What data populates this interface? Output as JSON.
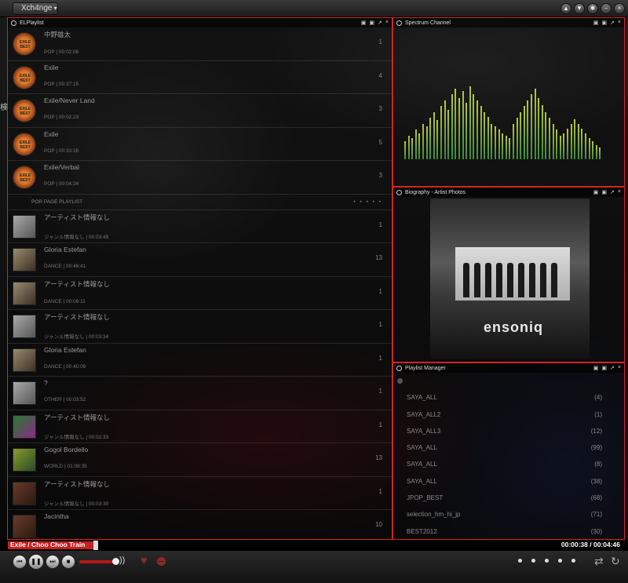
{
  "topbar": {
    "skin_menu": "Xch4nge",
    "buttons": [
      "up-icon",
      "down-icon",
      "gear-icon",
      "minimize-icon",
      "close-icon"
    ]
  },
  "side_glyph": "検",
  "playlist": {
    "title": "ELPlaylist",
    "items": [
      {
        "artist": "中野雄太",
        "song": "",
        "meta": "POP | 00:02:06",
        "num": "1",
        "thumb": "exile"
      },
      {
        "artist": "Exile",
        "song": "",
        "meta": "POP | 00:37:15",
        "num": "4",
        "thumb": "exile"
      },
      {
        "artist": "Exile/Never Land",
        "song": "",
        "meta": "POP | 00:02:23",
        "num": "3",
        "thumb": "exile"
      },
      {
        "artist": "Exile",
        "song": "",
        "meta": "POP | 00:33:16",
        "num": "5",
        "thumb": "exile"
      },
      {
        "artist": "Exile/Verbal",
        "song": "",
        "meta": "POP | 00:04:34",
        "num": "3",
        "thumb": "exile"
      }
    ],
    "pager_label": "POR PAGE PLAYLIST",
    "pager_dots": "• • • • •",
    "items2": [
      {
        "artist": "アーティスト情報なし",
        "song": "",
        "meta": "ジャンル情報なし | 00:03:49",
        "num": "1",
        "thumb": "white"
      },
      {
        "artist": "Gloria Estefan",
        "song": "",
        "meta": "DANCE | 00:46:41",
        "num": "13",
        "thumb": "gloria"
      },
      {
        "artist": "アーティスト情報なし",
        "song": "",
        "meta": "DANCE | 00:06:11",
        "num": "1",
        "thumb": "gloria"
      },
      {
        "artist": "アーティスト情報なし",
        "song": "",
        "meta": "ジャンル情報なし | 00:03:34",
        "num": "1",
        "thumb": "white"
      },
      {
        "artist": "Gloria Estefan",
        "song": "",
        "meta": "DANCE | 00:40:09",
        "num": "1",
        "thumb": "gloria"
      },
      {
        "artist": "?",
        "song": "",
        "meta": "OTHER | 00:03:52",
        "num": "1",
        "thumb": "white"
      },
      {
        "artist": "アーティスト情報なし",
        "song": "",
        "meta": "ジャンル情報なし | 00:02:33",
        "num": "1",
        "thumb": "green"
      },
      {
        "artist": "Gogol Bordello",
        "song": "",
        "meta": "WORLD | 01:08:35",
        "num": "13",
        "thumb": "gogol"
      },
      {
        "artist": "アーティスト情報なし",
        "song": "",
        "meta": "ジャンル情報なし | 00:03:30",
        "num": "1",
        "thumb": "brown"
      },
      {
        "artist": "Jacintha",
        "song": "",
        "meta": "",
        "num": "10",
        "thumb": "brown"
      }
    ]
  },
  "spectrum": {
    "title": "Spectrum Channel",
    "bars": [
      0.15,
      0.2,
      0.18,
      0.25,
      0.22,
      0.3,
      0.28,
      0.35,
      0.4,
      0.33,
      0.45,
      0.5,
      0.42,
      0.55,
      0.6,
      0.52,
      0.58,
      0.48,
      0.62,
      0.55,
      0.5,
      0.45,
      0.4,
      0.36,
      0.3,
      0.28,
      0.25,
      0.22,
      0.2,
      0.18,
      0.3,
      0.35,
      0.4,
      0.45,
      0.5,
      0.55,
      0.6,
      0.52,
      0.46,
      0.4,
      0.35,
      0.3,
      0.25,
      0.2,
      0.22,
      0.26,
      0.3,
      0.34,
      0.3,
      0.26,
      0.22,
      0.18,
      0.15,
      0.12,
      0.1
    ]
  },
  "biography": {
    "title": "Biography - Artist Photos",
    "photo_text": "ensoniq"
  },
  "playlist_manager": {
    "title": "Playlist Manager",
    "items": [
      {
        "name": "",
        "count": ""
      },
      {
        "name": "SAYA_ALL",
        "count": "(4)"
      },
      {
        "name": "SAYA_ALL2",
        "count": "(1)"
      },
      {
        "name": "SAYA_ALL3",
        "count": "(12)"
      },
      {
        "name": "SAYA_ALL",
        "count": "(99)"
      },
      {
        "name": "SAYA_ALL",
        "count": "(8)"
      },
      {
        "name": "SAYA_ALL",
        "count": "(38)"
      },
      {
        "name": "JPOP_BEST",
        "count": "(68)"
      },
      {
        "name": "selection_hm_hi_jp",
        "count": "(71)"
      },
      {
        "name": "BEST2012",
        "count": "(30)"
      }
    ]
  },
  "now_playing": {
    "title": "Exile / Choo Choo Train",
    "time": "00:00:38 / 00:04:46",
    "progress": 0.14
  },
  "controls": {
    "prev": "previous-icon",
    "pause": "pause-icon",
    "next": "next-icon",
    "stop": "stop-icon",
    "volume": 0.9,
    "volume_icon": "))",
    "love_icon": "♥",
    "shuffle_icon": "⇄",
    "repeat_icon": "↻"
  },
  "colors": {
    "accent": "#d12525",
    "progress": "#c51f1f",
    "song_text": "#7a1010"
  }
}
